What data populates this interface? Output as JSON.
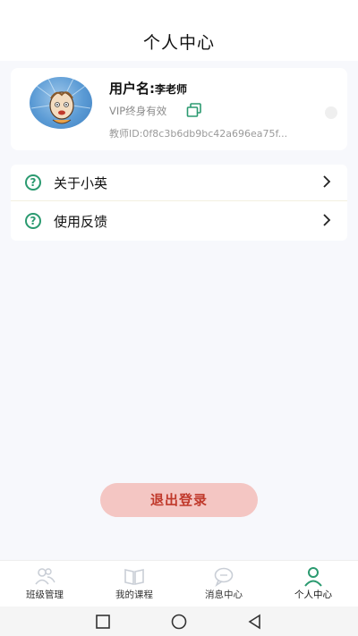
{
  "header": {
    "title": "个人中心"
  },
  "profile": {
    "username_label": "用户名:",
    "username_value": "李老师",
    "vip_text": "VIP终身有效",
    "teacher_id": "教师ID:0f8c3b6db9bc42a696ea75f..."
  },
  "menu": {
    "items": [
      {
        "label": "关于小英",
        "icon": "question-circle-icon"
      },
      {
        "label": "使用反馈",
        "icon": "question-circle-icon"
      }
    ]
  },
  "logout": {
    "label": "退出登录"
  },
  "bottom_nav": {
    "items": [
      {
        "label": "班级管理",
        "icon": "users-icon"
      },
      {
        "label": "我的课程",
        "icon": "book-icon"
      },
      {
        "label": "消息中心",
        "icon": "chat-bubble-icon"
      },
      {
        "label": "个人中心",
        "icon": "user-icon"
      }
    ],
    "active_index": 3
  },
  "colors": {
    "accent_green": "#2b9a70",
    "logout_bg": "#f4c6c3",
    "logout_text": "#c0392b",
    "page_bg": "#f7f8fc"
  }
}
